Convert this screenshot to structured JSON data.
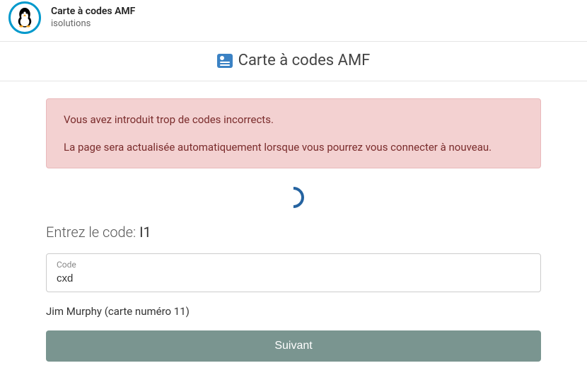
{
  "header": {
    "title": "Carte à codes AMF",
    "subtitle": "isolutions"
  },
  "page": {
    "title": "Carte à codes AMF"
  },
  "alert": {
    "line1": "Vous avez introduit trop de codes incorrects.",
    "line2": "La page sera actualisée automatiquement lorsque vous pourrez vous connecter à nouveau."
  },
  "form": {
    "prompt_label": "Entrez le code: ",
    "prompt_code": "I1",
    "input_label": "Code",
    "input_value": "cxd",
    "card_info": "Jim Murphy (carte numéro 11)",
    "submit_label": "Suivant"
  }
}
